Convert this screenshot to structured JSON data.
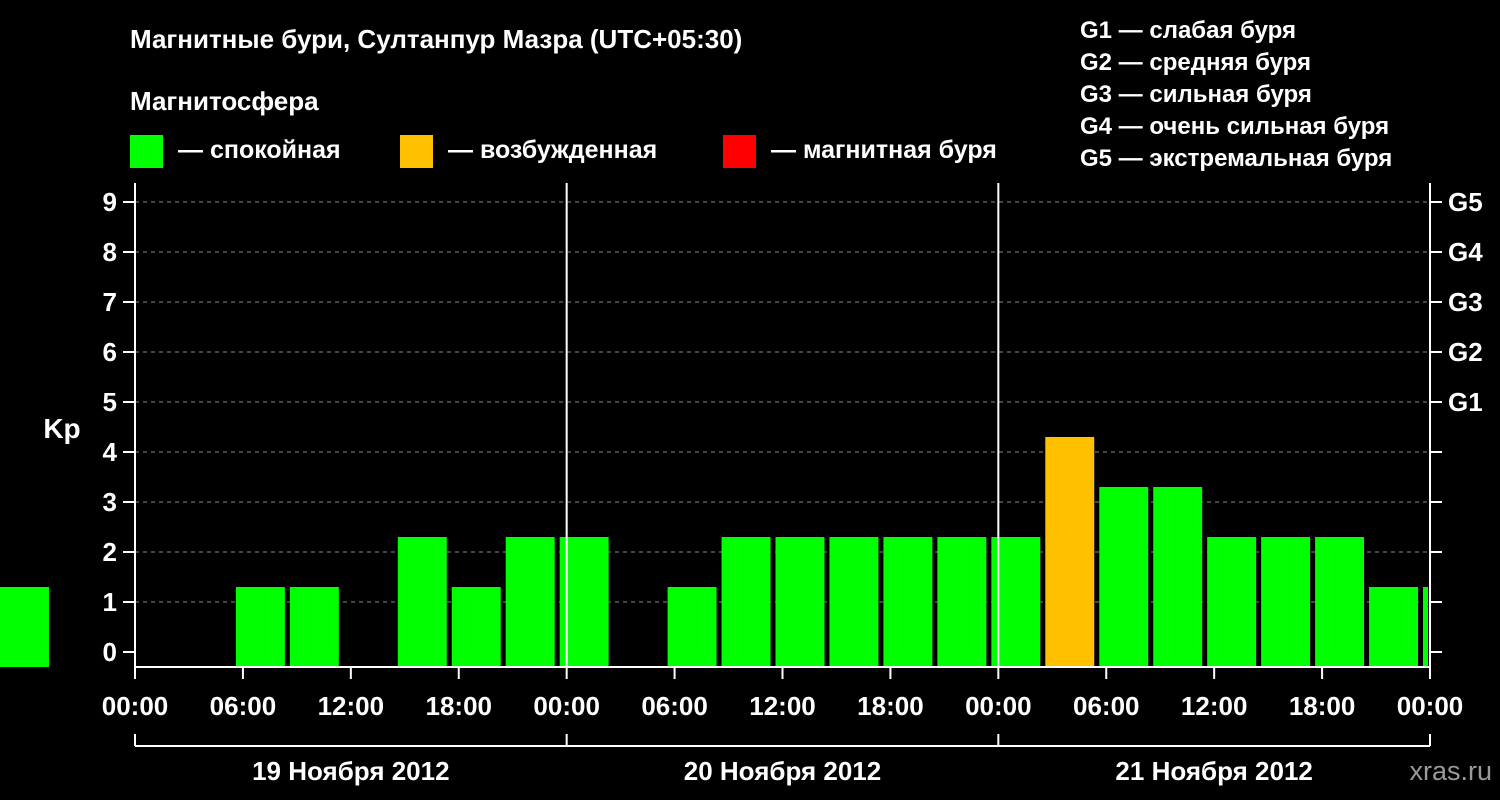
{
  "chart_data": {
    "type": "bar",
    "title": "Магнитные бури, Султанпур Мазра (UTC+05:30)",
    "legend_title": "Магнитосфера",
    "legend": [
      {
        "name": "— спокойная",
        "color": "#00ff00"
      },
      {
        "name": "— возбужденная",
        "color": "#ffc000"
      },
      {
        "name": "— магнитная буря",
        "color": "#ff0000"
      }
    ],
    "g_scale": [
      "G1 — слабая буря",
      "G2 — средняя буря",
      "G3 — сильная буря",
      "G4 — очень сильная буря",
      "G5 — экстремальная буря"
    ],
    "ylabel": "Kp",
    "ylim": [
      0,
      9
    ],
    "yticks": [
      "0",
      "1",
      "2",
      "3",
      "4",
      "5",
      "6",
      "7",
      "8",
      "9"
    ],
    "right_ticks": [
      {
        "kp": 5,
        "label": "G1"
      },
      {
        "kp": 6,
        "label": "G2"
      },
      {
        "kp": 7,
        "label": "G3"
      },
      {
        "kp": 8,
        "label": "G4"
      },
      {
        "kp": 9,
        "label": "G5"
      }
    ],
    "xticks": [
      "00:00",
      "06:00",
      "12:00",
      "18:00",
      "00:00",
      "06:00",
      "12:00",
      "18:00",
      "00:00",
      "06:00",
      "12:00",
      "18:00",
      "00:00"
    ],
    "days": [
      "19 Ноября 2012",
      "20 Ноября 2012",
      "21 Ноября 2012"
    ],
    "hours_total": 72,
    "bar_start_hours": [
      2.5,
      5.5,
      8.5,
      11.5,
      14.5,
      17.5,
      20.5,
      23.5,
      26.5,
      29.5,
      32.5,
      35.5,
      38.5,
      41.5,
      44.5,
      47.5,
      50.5,
      53.5,
      56.5,
      59.5,
      62.5,
      65.5,
      68.5,
      71.5
    ],
    "kp_values": [
      0,
      1,
      1,
      0,
      2,
      1,
      2,
      2,
      0,
      1,
      2,
      2,
      2,
      2,
      2,
      2,
      4,
      3,
      3,
      2,
      2,
      2,
      1,
      1,
      1
    ],
    "colors": {
      "calm": "#00ff00",
      "active": "#ffc000",
      "storm": "#ff0000",
      "grid": "#888888",
      "axis": "#ffffff"
    },
    "watermark": "xras.ru"
  }
}
